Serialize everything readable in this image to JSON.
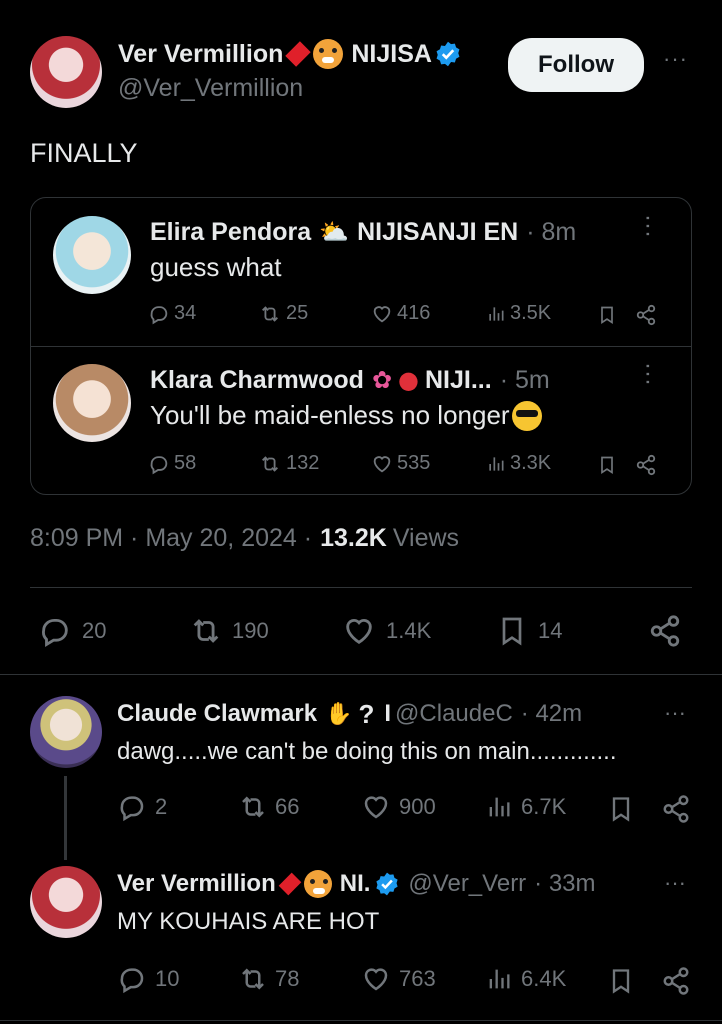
{
  "main_tweet": {
    "author_name": "Ver Vermillion",
    "author_suffix": "NIJISA",
    "handle": "@Ver_Vermillion",
    "follow_label": "Follow",
    "more_label": "···",
    "text": "FINALLY",
    "quotes": [
      {
        "author_name": "Elira Pendora",
        "author_suffix": "NIJISANJI EN",
        "time": "· 8m",
        "text": "guess what",
        "replies": "34",
        "reposts": "25",
        "likes": "416",
        "views": "3.5K"
      },
      {
        "author_name": "Klara Charmwood",
        "author_suffix": "NIJI...",
        "time": "· 5m",
        "text": "You'll be maid-enless no longer",
        "replies": "58",
        "reposts": "132",
        "likes": "535",
        "views": "3.3K"
      }
    ],
    "timestamp": "8:09 PM · May 20, 2024 ·",
    "views_count": "13.2K",
    "views_label": "Views",
    "replies": "20",
    "reposts": "190",
    "likes": "1.4K",
    "bookmarks": "14"
  },
  "replies": [
    {
      "author_name": "Claude Clawmark",
      "handle": "@ClaudeC",
      "time": "· 42m",
      "text": "dawg.....we can't be doing this on main.............",
      "replies": "2",
      "reposts": "66",
      "likes": "900",
      "views": "6.7K"
    },
    {
      "author_name": "Ver Vermillion",
      "author_suffix": "NI.",
      "handle": "@Ver_Verr",
      "time": "· 33m",
      "text": "MY KOUHAIS ARE HOT",
      "replies": "10",
      "reposts": "78",
      "likes": "763",
      "views": "6.4K"
    }
  ],
  "colors": {
    "background": "#000000",
    "text": "#e7e9ea",
    "muted": "#71767b",
    "divider": "#2f3336",
    "verified": "#1d9bf0"
  }
}
